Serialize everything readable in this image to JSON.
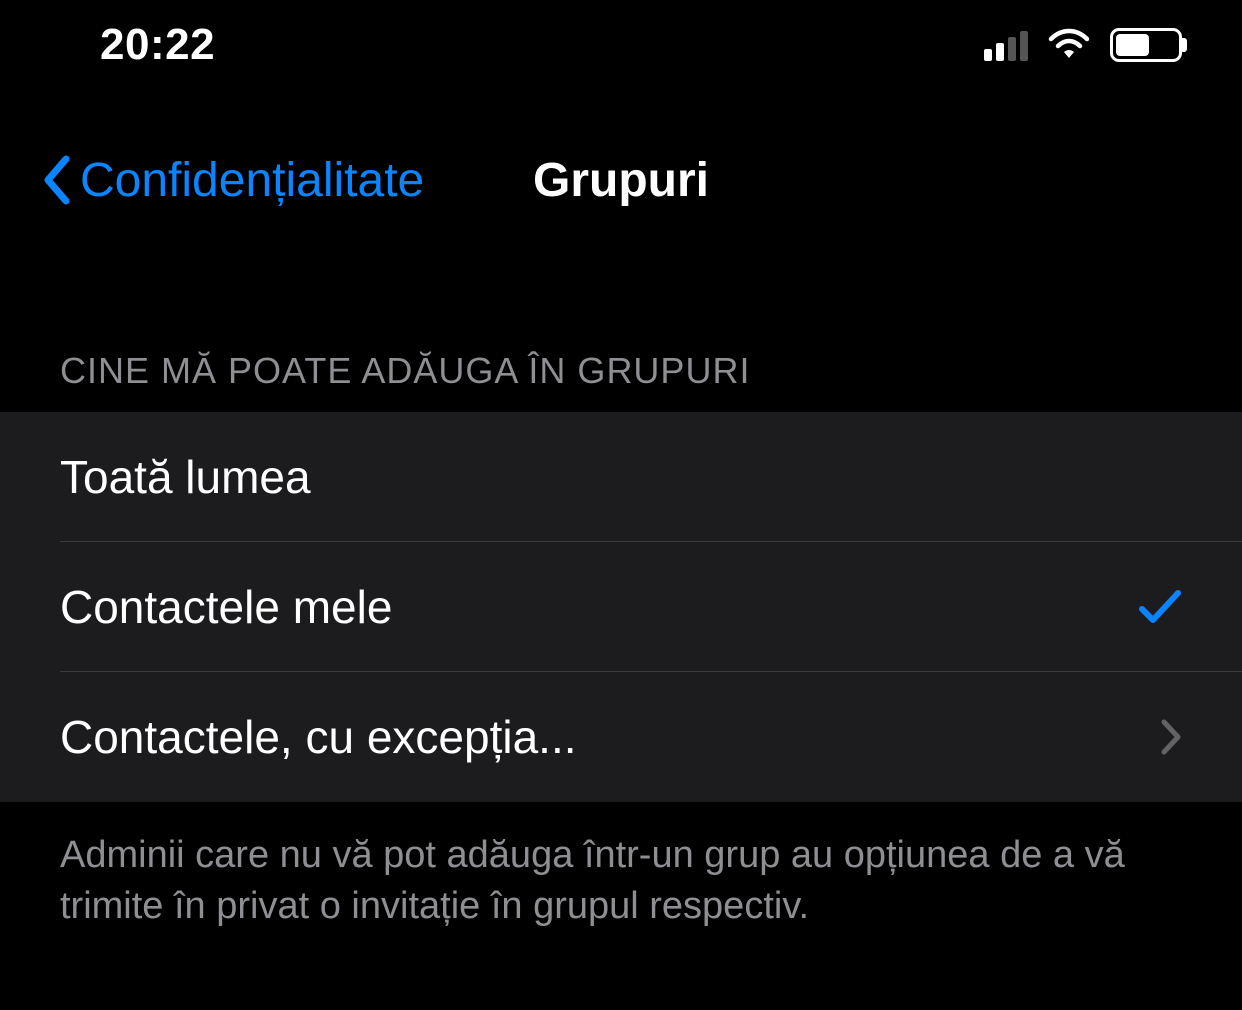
{
  "status": {
    "time": "20:22"
  },
  "nav": {
    "back_label": "Confidențialitate",
    "title": "Grupuri"
  },
  "section": {
    "header": "CINE MĂ POATE ADĂUGA ÎN GRUPURI",
    "items": [
      {
        "label": "Toată lumea",
        "selected": false,
        "hasChevron": false
      },
      {
        "label": "Contactele mele",
        "selected": true,
        "hasChevron": false
      },
      {
        "label": "Contactele, cu excepția...",
        "selected": false,
        "hasChevron": true
      }
    ],
    "footer": "Adminii care nu vă pot adăuga într-un grup au opțiunea de a vă trimite în privat o invitație în grupul respectiv."
  },
  "colors": {
    "accent": "#0a84ff",
    "background": "#000000",
    "listBackground": "#1c1c1e",
    "secondaryText": "#8e8e93"
  }
}
